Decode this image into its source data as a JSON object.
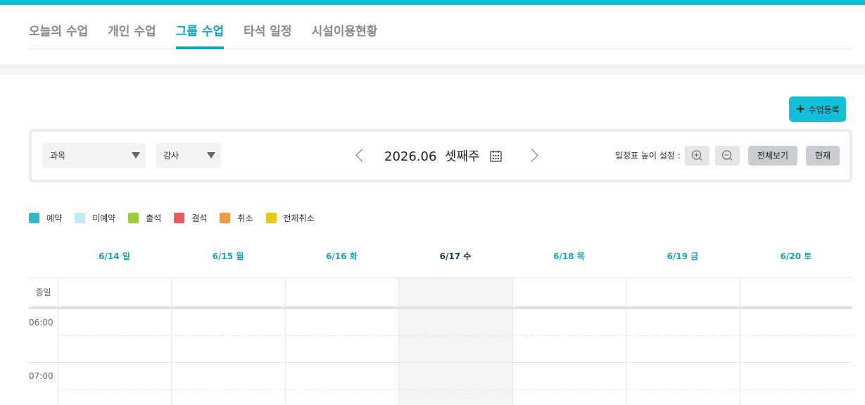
{
  "tabs": [
    {
      "label": "오늘의 수업",
      "active": false
    },
    {
      "label": "개인 수업",
      "active": false
    },
    {
      "label": "그룹 수업",
      "active": true
    },
    {
      "label": "타석 일정",
      "active": false
    },
    {
      "label": "시설이용현황",
      "active": false
    }
  ],
  "toolbar": {
    "add_label": "수업등록",
    "add_icon": "plus-icon"
  },
  "filters": {
    "subject_label": "과목",
    "teacher_label": "강사"
  },
  "week": {
    "label": "2026.06  셋째주",
    "prev_icon": "chevron-left-icon",
    "next_icon": "chevron-right-icon",
    "calendar_icon": "calendar-icon"
  },
  "height_setting": {
    "label": "일정표 높이 설정 :",
    "zoom_in_icon": "zoom-in-icon",
    "zoom_out_icon": "zoom-out-icon"
  },
  "buttons": {
    "view_all": "전체보기",
    "now": "현재"
  },
  "legend": [
    {
      "label": "예약",
      "color": "#32b8cd"
    },
    {
      "label": "미예약",
      "color": "#c6eaf1"
    },
    {
      "label": "출석",
      "color": "#9ccc3a"
    },
    {
      "label": "결석",
      "color": "#ea5b5b"
    },
    {
      "label": "취소",
      "color": "#ef9a48"
    },
    {
      "label": "전체취소",
      "color": "#e6c912"
    }
  ],
  "days": [
    {
      "label": "6/14 일",
      "today": false
    },
    {
      "label": "6/15 월",
      "today": false
    },
    {
      "label": "6/16 화",
      "today": false
    },
    {
      "label": "6/17 수",
      "today": true
    },
    {
      "label": "6/18 목",
      "today": false
    },
    {
      "label": "6/19 금",
      "today": false
    },
    {
      "label": "6/20 토",
      "today": false
    }
  ],
  "rows": {
    "all_day": "종일",
    "times": [
      "06:00",
      "07:00"
    ]
  },
  "colors": {
    "accent": "#0aa5bd",
    "top_bar": "#0cbcd8",
    "add_button": "#12bfd9",
    "today_text": "#123d5c"
  }
}
